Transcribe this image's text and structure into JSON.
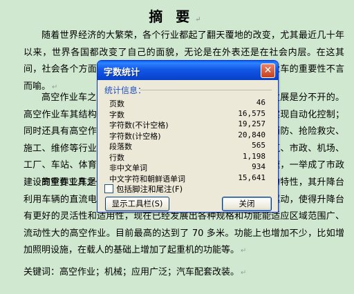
{
  "document": {
    "title": "摘 要",
    "paragraphs": [
      "随着世界经济的大繁荣，各个行业都起了翻天覆地的改变，尤其最近几十年以来，世界各国都改变了自己的面貌，无论是在外表还是在社会内层。在这其间，社会各个方面的需求都在不断地增加，包括其中，高空作业车的重要性不言而喻。",
      "高空作业车之所以能够迅速发展，与它本身的结构和技术发展是分不开的。高空作业车其结构主要由底盘、上车、液压系统等组成，便于实现自动化控制；同时还具有高空作业、起重吊装等多种功能，广泛应用于从事消防、抢险救灾、施工、维修等行业，以及园林、电力、通信、广告、摄影、建筑、市政、机场、工厂、车站、体育场馆等高空作业场所。高空作业车发展很迅速，一举成了市政建设的重要工具之一。",
      "高空作业车是一种特种专用车辆，具有一般车辆所不具备的特性，其升降台利用车辆的直流电及发动机进行驱动，同时也可以用外部电源驱动，使得升降台有更好的灵活性和适用性，现在已经发展出各种规格和功能能适应区域范围广、流动性大的高空作业。目前最高的达到了 70 多米。功能上也增加不少，比如增加照明设施，在载人的基础上增加了起重机的功能等。"
    ],
    "keywords": "关键词：高空作业；机械；应用广泛；汽车配套改装。"
  },
  "dialog": {
    "title": "字数统计",
    "close_glyph": "✕",
    "section_label": "统计信息：",
    "stats": [
      {
        "label": "页数",
        "value": "46"
      },
      {
        "label": "字数",
        "value": "16,575"
      },
      {
        "label": "字符数(不计空格)",
        "value": "19,257"
      },
      {
        "label": "字符数(计空格)",
        "value": "20,840"
      },
      {
        "label": "段落数",
        "value": "565"
      },
      {
        "label": "行数",
        "value": "1,198"
      },
      {
        "label": "非中文单词",
        "value": "934"
      },
      {
        "label": "中文字符和朝鲜语单词",
        "value": "15,641"
      }
    ],
    "checkbox_label": "包括脚注和尾注(F)",
    "checkbox_checked": false,
    "toolbar_button": "显示工具栏(S)",
    "close_button": "关闭"
  },
  "colors": {
    "page_background": "#cfe8cf",
    "dialog_face": "#ece9d8",
    "titlebar_blue": "#0a46d2",
    "section_label_blue": "#1e4fbd",
    "close_button_red": "#c5411e"
  }
}
